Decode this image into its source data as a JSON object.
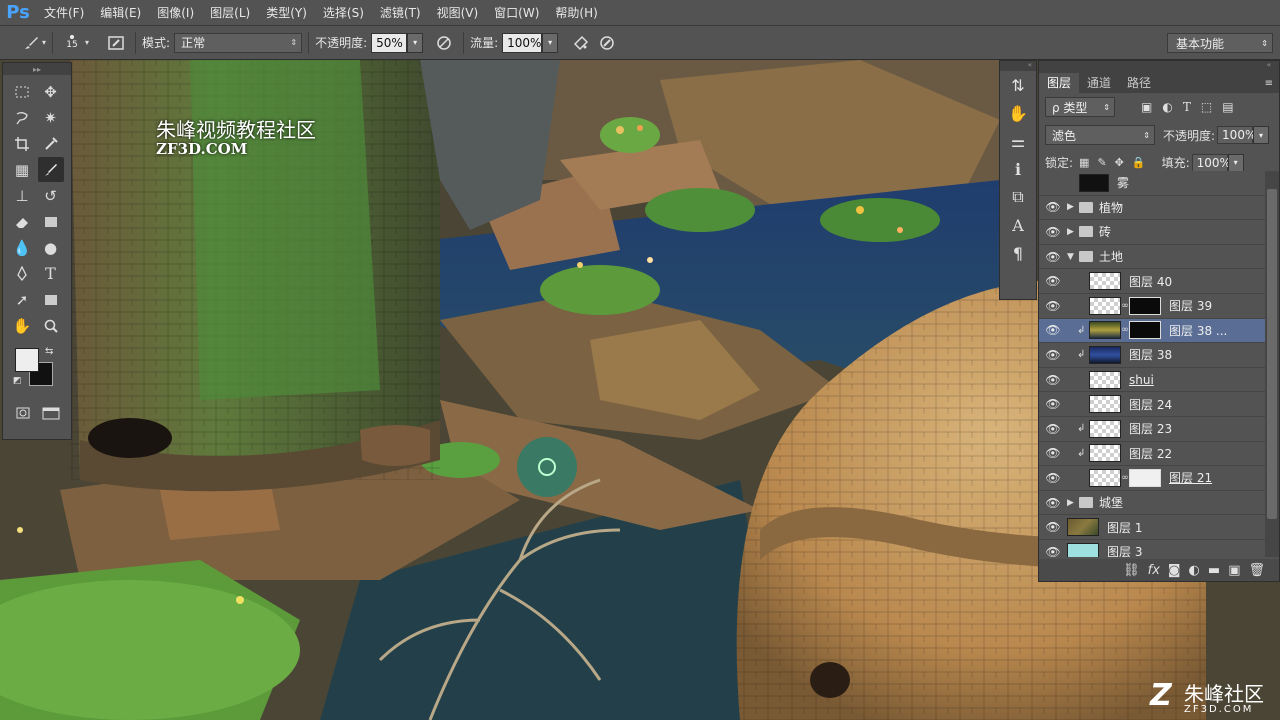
{
  "app": {
    "logo": "Ps"
  },
  "menu": [
    "文件(F)",
    "编辑(E)",
    "图像(I)",
    "图层(L)",
    "类型(Y)",
    "选择(S)",
    "滤镜(T)",
    "视图(V)",
    "窗口(W)",
    "帮助(H)"
  ],
  "options": {
    "brush_size": "15",
    "mode_label": "模式:",
    "mode_value": "正常",
    "opacity_label": "不透明度:",
    "opacity_value": "50%",
    "flow_label": "流量:",
    "flow_value": "100%"
  },
  "workspace": "基本功能",
  "canvas": {
    "watermark_title": "朱峰视频教程社区",
    "watermark_url": "ZF3D.COM",
    "logo_text": "朱峰社区",
    "logo_url": "ZF3D.COM"
  },
  "layers_panel": {
    "tabs": [
      "图层",
      "通道",
      "路径"
    ],
    "filter_label": "ρ 类型",
    "blend_mode": "滤色",
    "opacity_label": "不透明度:",
    "opacity_value": "100%",
    "lock_label": "锁定:",
    "fill_label": "填充:",
    "fill_value": "100%",
    "layers": [
      {
        "name": "雾",
        "visible": false,
        "type": "layer-dark"
      },
      {
        "name": "植物",
        "visible": true,
        "type": "group-collapsed"
      },
      {
        "name": "砖",
        "visible": true,
        "type": "group-collapsed"
      },
      {
        "name": "土地",
        "visible": true,
        "type": "group-open"
      },
      {
        "name": "图层 40",
        "visible": true,
        "type": "layer"
      },
      {
        "name": "图层 39",
        "visible": true,
        "type": "layer-mask"
      },
      {
        "name": "图层 38 ...",
        "visible": true,
        "type": "layer-mask-clip",
        "selected": true
      },
      {
        "name": "图层 38",
        "visible": true,
        "type": "layer-clip"
      },
      {
        "name": "shui",
        "visible": true,
        "type": "layer"
      },
      {
        "name": "图层 24",
        "visible": true,
        "type": "layer"
      },
      {
        "name": "图层 23",
        "visible": true,
        "type": "layer-clip"
      },
      {
        "name": "图层 22",
        "visible": true,
        "type": "layer-clip"
      },
      {
        "name": "图层 21",
        "visible": true,
        "type": "layer-mask"
      },
      {
        "name": "城堡",
        "visible": true,
        "type": "group-collapsed-top"
      },
      {
        "name": "图层 1",
        "visible": true,
        "type": "layer-photo"
      },
      {
        "name": "图层 3",
        "visible": true,
        "type": "layer-cyan"
      }
    ],
    "footer_icons": [
      "link-icon",
      "fx-icon",
      "mask-icon",
      "adjustment-icon",
      "folder-icon",
      "new-layer-icon",
      "trash-icon"
    ]
  },
  "colors": {
    "accent": "#5a6e95",
    "panel": "#535353",
    "foreground": "#eeeeee",
    "background": "#111111"
  }
}
